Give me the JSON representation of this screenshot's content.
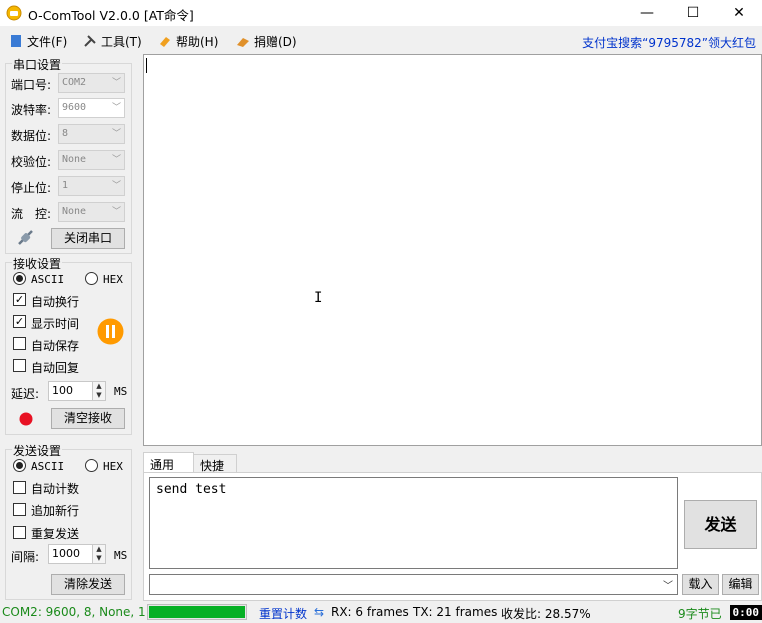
{
  "window": {
    "title": "O-ComTool V2.0.0 [AT命令]",
    "minimize": "—",
    "maximize": "☐",
    "close": "✕"
  },
  "menu": {
    "items": [
      {
        "label": "文件(F)",
        "icon": "file-icon"
      },
      {
        "label": "工具(T)",
        "icon": "tools-icon"
      },
      {
        "label": "帮助(H)",
        "icon": "help-icon"
      },
      {
        "label": "捐赠(D)",
        "icon": "donate-icon"
      }
    ],
    "promo": "支付宝搜索“9795782”领大红包"
  },
  "serial": {
    "title": "串口设置",
    "rows": [
      {
        "label": "端口号:",
        "value": "COM2"
      },
      {
        "label": "波特率:",
        "value": "9600"
      },
      {
        "label": "数据位:",
        "value": "8"
      },
      {
        "label": "校验位:",
        "value": "None"
      },
      {
        "label": "停止位:",
        "value": "1"
      },
      {
        "label": "流　控:",
        "value": "None"
      }
    ],
    "close_button": "关闭串口"
  },
  "receive": {
    "title": "接收设置",
    "ascii": "ASCII",
    "hex": "HEX",
    "options": [
      {
        "label": "自动换行",
        "checked": true
      },
      {
        "label": "显示时间",
        "checked": true
      },
      {
        "label": "自动保存",
        "checked": false
      },
      {
        "label": "自动回复",
        "checked": false
      }
    ],
    "delay_label": "延迟:",
    "delay_value": "100",
    "delay_unit": "MS",
    "clear_button": "清空接收"
  },
  "send": {
    "title": "发送设置",
    "ascii": "ASCII",
    "hex": "HEX",
    "options": [
      {
        "label": "自动计数",
        "checked": false
      },
      {
        "label": "追加新行",
        "checked": false
      },
      {
        "label": "重复发送",
        "checked": false
      }
    ],
    "interval_label": "间隔:",
    "interval_value": "1000",
    "interval_unit": "MS",
    "clear_button": "清除发送"
  },
  "tabs": [
    "通用",
    "快捷"
  ],
  "send_text": "send test",
  "send_button": "发送",
  "load_button": "载入",
  "edit_button": "编辑",
  "status": {
    "port": "COM2: 9600, 8, None, 1",
    "progress": 1.0,
    "reset": "重置计数",
    "rx": "RX: 6 frames",
    "tx": "TX: 21 frames",
    "ratio": "收发比:  28.57%",
    "sent": "9字节已",
    "clock": "0:00"
  },
  "colors": {
    "accent_green": "#06b025",
    "promo_blue": "#0033cc",
    "record_red": "#e81123",
    "pause_orange": "#ff9a00"
  }
}
